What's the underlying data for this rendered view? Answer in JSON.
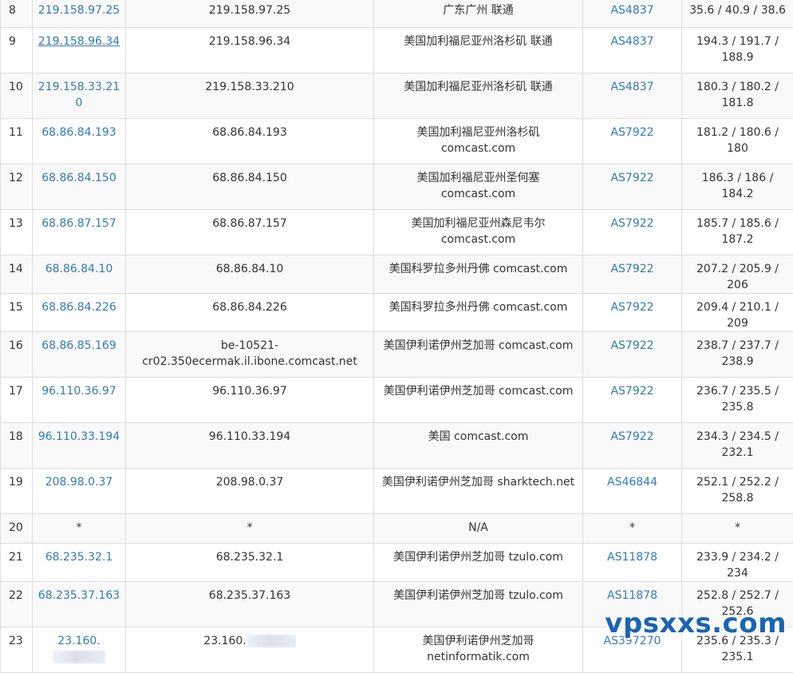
{
  "table": {
    "rows": [
      {
        "hop": "8",
        "ip": "219.158.97.25",
        "hostname": "219.158.97.25",
        "location": [
          "广东广州 联通"
        ],
        "asn": "AS4837",
        "latency": [
          "35.6 / 40.9 / 38.6"
        ],
        "ip_underline": false
      },
      {
        "hop": "9",
        "ip": "219.158.96.34",
        "hostname": "219.158.96.34",
        "location": [
          "美国加利福尼亚州洛杉矶 联通"
        ],
        "asn": "AS4837",
        "latency": [
          "194.3 / 191.7 /",
          "188.9"
        ],
        "ip_underline": true
      },
      {
        "hop": "10",
        "ip": "219.158.33.210",
        "hostname": "219.158.33.210",
        "location": [
          "美国加利福尼亚州洛杉矶 联通"
        ],
        "asn": "AS4837",
        "latency": [
          "180.3 / 180.2 /",
          "181.8"
        ],
        "ip_underline": false
      },
      {
        "hop": "11",
        "ip": "68.86.84.193",
        "hostname": "68.86.84.193",
        "location": [
          "美国加利福尼亚州洛杉矶",
          "comcast.com"
        ],
        "asn": "AS7922",
        "latency": [
          "181.2 / 180.6 / 180"
        ],
        "ip_underline": false
      },
      {
        "hop": "12",
        "ip": "68.86.84.150",
        "hostname": "68.86.84.150",
        "location": [
          "美国加利福尼亚州圣何塞",
          "comcast.com"
        ],
        "asn": "AS7922",
        "latency": [
          "186.3 / 186 / 184.2"
        ],
        "ip_underline": false
      },
      {
        "hop": "13",
        "ip": "68.86.87.157",
        "hostname": "68.86.87.157",
        "location": [
          "美国加利福尼亚州森尼韦尔",
          "comcast.com"
        ],
        "asn": "AS7922",
        "latency": [
          "185.7 / 185.6 /",
          "187.2"
        ],
        "ip_underline": false
      },
      {
        "hop": "14",
        "ip": "68.86.84.10",
        "hostname": "68.86.84.10",
        "location": [
          "美国科罗拉多州丹佛 comcast.com"
        ],
        "asn": "AS7922",
        "latency": [
          "207.2 / 205.9 / 206"
        ],
        "ip_underline": false
      },
      {
        "hop": "15",
        "ip": "68.86.84.226",
        "hostname": "68.86.84.226",
        "location": [
          "美国科罗拉多州丹佛 comcast.com"
        ],
        "asn": "AS7922",
        "latency": [
          "209.4 / 210.1 / 209"
        ],
        "ip_underline": false
      },
      {
        "hop": "16",
        "ip": "68.86.85.169",
        "hostname": "be-10521-cr02.350ecermak.il.ibone.comcast.net",
        "hostname_lines": [
          "be-10521-",
          "cr02.350ecermak.il.ibone.comcast.net"
        ],
        "location": [
          "美国伊利诺伊州芝加哥 comcast.com"
        ],
        "asn": "AS7922",
        "latency": [
          "238.7 / 237.7 /",
          "238.9"
        ],
        "ip_underline": false
      },
      {
        "hop": "17",
        "ip": "96.110.36.97",
        "hostname": "96.110.36.97",
        "location": [
          "美国伊利诺伊州芝加哥 comcast.com"
        ],
        "asn": "AS7922",
        "latency": [
          "236.7 / 235.5 /",
          "235.8"
        ],
        "ip_underline": false
      },
      {
        "hop": "18",
        "ip": "96.110.33.194",
        "hostname": "96.110.33.194",
        "location": [
          "美国 comcast.com"
        ],
        "asn": "AS7922",
        "latency": [
          "234.3 / 234.5 /",
          "232.1"
        ],
        "ip_underline": false
      },
      {
        "hop": "19",
        "ip": "208.98.0.37",
        "hostname": "208.98.0.37",
        "location": [
          "美国伊利诺伊州芝加哥 sharktech.net"
        ],
        "asn": "AS46844",
        "latency": [
          "252.1 / 252.2 /",
          "258.8"
        ],
        "ip_underline": false
      },
      {
        "hop": "20",
        "ip": "*",
        "hostname": "*",
        "location": [
          "N/A"
        ],
        "asn": "*",
        "latency": [
          "*"
        ],
        "ip_underline": false,
        "plain": true
      },
      {
        "hop": "21",
        "ip": "68.235.32.1",
        "hostname": "68.235.32.1",
        "location": [
          "美国伊利诺伊州芝加哥 tzulo.com"
        ],
        "asn": "AS11878",
        "latency": [
          "233.9 / 234.2 / 234"
        ],
        "ip_underline": false
      },
      {
        "hop": "22",
        "ip": "68.235.37.163",
        "hostname": "68.235.37.163",
        "location": [
          "美国伊利诺伊州芝加哥 tzulo.com"
        ],
        "asn": "AS11878",
        "latency": [
          "252.8 / 252.7 /",
          "252.6"
        ],
        "ip_underline": false
      },
      {
        "hop": "23",
        "ip": "23.160.",
        "hostname": "23.160.",
        "location": [
          "美国伊利诺伊州芝加哥",
          "netinformatik.com"
        ],
        "asn": "AS397270",
        "latency": [
          "235.6 / 235.3 /",
          "235.1"
        ],
        "ip_underline": false,
        "redacted": true
      }
    ]
  },
  "watermark": "vpsxxs.com",
  "colors": {
    "link": "#337ab7",
    "border": "#dddddd",
    "stripe": "#f9f9f9",
    "watermark": "#1a64b4"
  }
}
